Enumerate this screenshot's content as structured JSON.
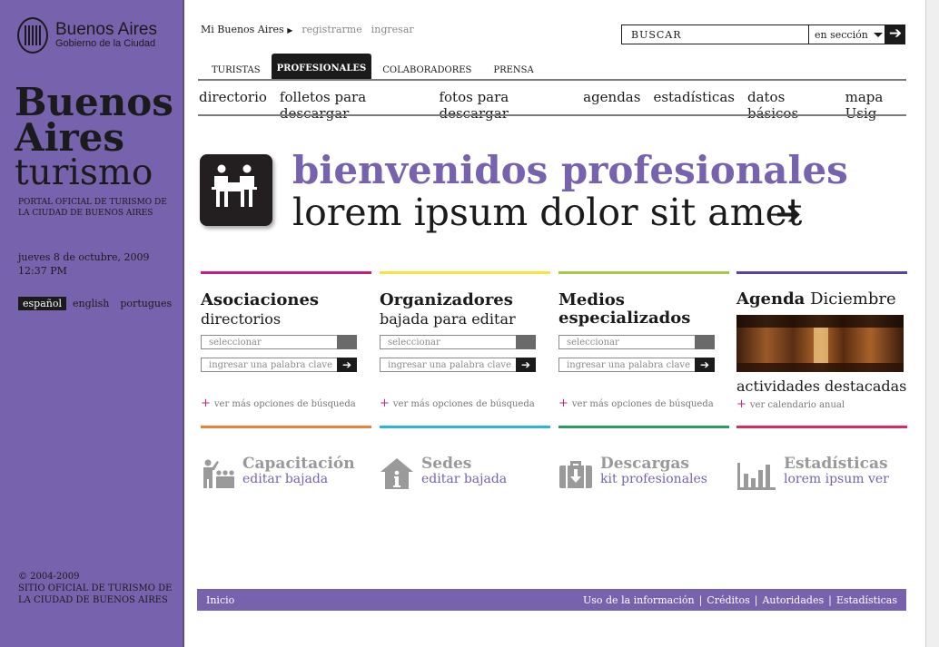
{
  "sidebar": {
    "logo_name": "Buenos Aires",
    "logo_sub": "Gobierno de la Ciudad",
    "brand_line1": "Buenos",
    "brand_line2": "Aires",
    "brand_line3": "turismo",
    "tagline": "PORTAL OFICIAL DE TURISMO DE LA CIUDAD DE BUENOS AIRES",
    "date": "jueves 8 de octubre, 2009",
    "time": "12:37 PM",
    "languages": [
      "español",
      "english",
      "portugues"
    ],
    "active_language": "español",
    "copyright_line1": "© 2004-2009",
    "copyright_line2": "SITIO OFICIAL DE TURISMO DE LA CIUDAD DE BUENOS AIRES"
  },
  "header": {
    "mi_buenos_aires": "Mi Buenos Aires",
    "registrarme": "registrarme",
    "ingresar": "ingresar",
    "search_placeholder": "BUSCAR",
    "search_scope": "en sección",
    "search_go": "➔"
  },
  "tabs": [
    {
      "label": "TURISTAS",
      "active": false
    },
    {
      "label": "PROFESIONALES",
      "active": true
    },
    {
      "label": "COLABORADORES",
      "active": false
    },
    {
      "label": "PRENSA",
      "active": false
    }
  ],
  "subnav": [
    "directorio",
    "folletos para descargar",
    "fotos para descargar",
    "agendas",
    "estadísticas",
    "datos básicos",
    "mapa Usig"
  ],
  "hero": {
    "title": "bienvenidos profesionales",
    "subtitle": "lorem ipsum dolor sit amet",
    "arrow": "➔"
  },
  "columns": [
    {
      "title": "Asociaciones",
      "subtitle": "directorios",
      "select": "seleccionar",
      "keyword": "ingresar una palabra clave",
      "more": "ver más opciones de búsqueda",
      "color": "#c81f7e"
    },
    {
      "title": "Organizadores",
      "subtitle": "bajada para editar",
      "select": "seleccionar",
      "keyword": "ingresar una palabra clave",
      "more": "ver más opciones de búsqueda",
      "color": "#f3e53f"
    },
    {
      "title": "Medios especializados",
      "subtitle": "",
      "select": "seleccionar",
      "keyword": "ingresar una palabra clave",
      "more": "ver más opciones de búsqueda",
      "color": "#a8c84a"
    }
  ],
  "agenda": {
    "title_bold": "Agenda",
    "title_month": "Diciembre",
    "activities": "actividades destacadas",
    "more": "ver calendario anual",
    "color": "#5a4399"
  },
  "features": [
    {
      "title": "Capacitación",
      "subtitle": "editar bajada",
      "icon": "training-icon",
      "color": "#e8823a"
    },
    {
      "title": "Sedes",
      "subtitle": "editar bajada",
      "icon": "info-house-icon",
      "color": "#2bb6d9"
    },
    {
      "title": "Descargas",
      "subtitle": "kit profesionales",
      "icon": "download-briefcase-icon",
      "color": "#2b9a67"
    },
    {
      "title": "Estadísticas",
      "subtitle": "lorem ipsum ver",
      "icon": "bar-chart-icon",
      "color": "#d62d5f"
    }
  ],
  "footer": {
    "home": "Inicio",
    "links": [
      "Uso de la información",
      "Créditos",
      "Autoridades",
      "Estadísticas"
    ]
  }
}
